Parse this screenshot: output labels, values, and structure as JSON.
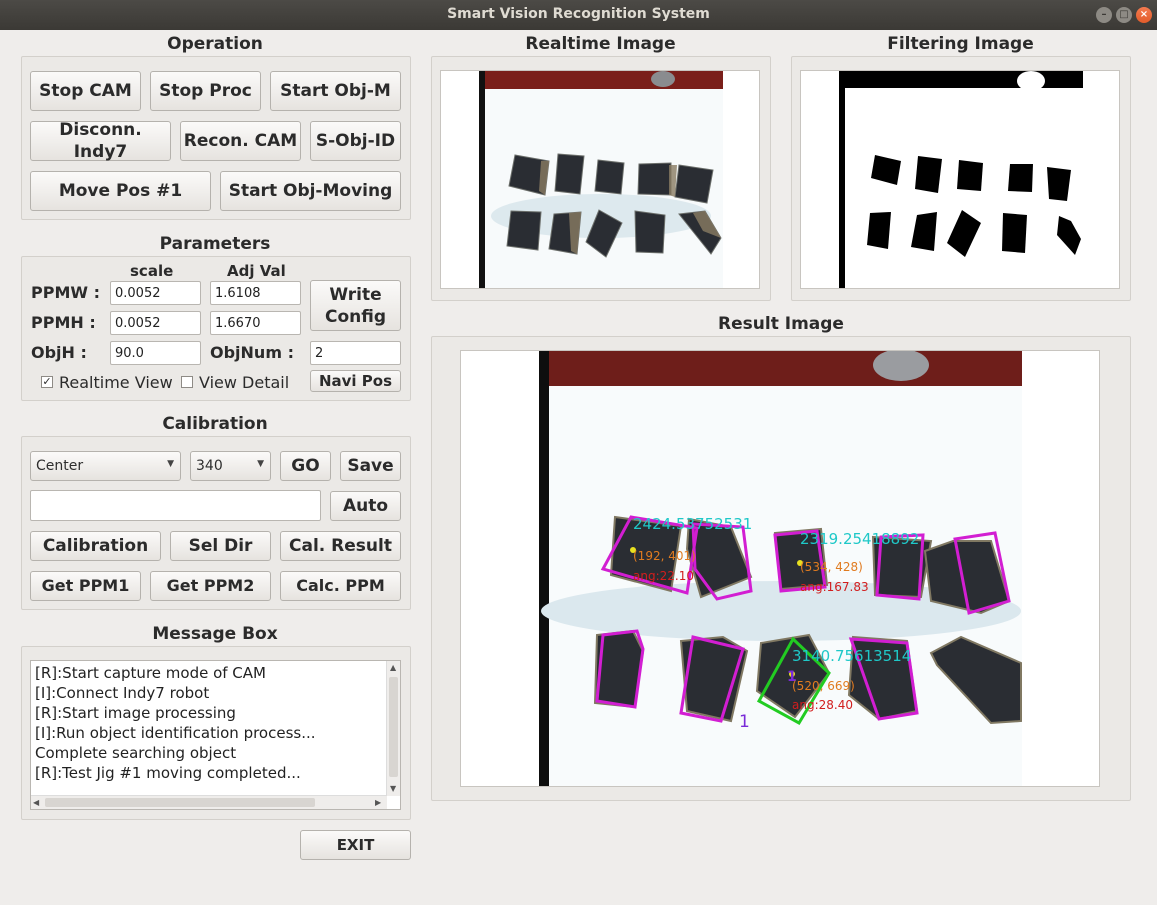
{
  "window": {
    "title": "Smart Vision Recognition System",
    "controls": [
      "minimize-icon",
      "maximize-icon",
      "close-icon"
    ]
  },
  "operation": {
    "title": "Operation",
    "buttons": {
      "stop_cam": "Stop CAM",
      "stop_proc": "Stop Proc",
      "start_obj_m": "Start Obj-M",
      "disconn_indy7": "Disconn. Indy7",
      "recon_cam": "Recon. CAM",
      "s_obj_id": "S-Obj-ID",
      "move_pos_1": "Move Pos #1",
      "start_obj_moving": "Start Obj-Moving"
    }
  },
  "parameters": {
    "title": "Parameters",
    "col_scale": "scale",
    "col_adj": "Adj Val",
    "ppmw_label": "PPMW :",
    "ppmw_scale": "0.0052",
    "ppmw_adj": "1.6108",
    "ppmh_label": "PPMH :",
    "ppmh_scale": "0.0052",
    "ppmh_adj": "1.6670",
    "objh_label": "ObjH :",
    "objh_value": "90.0",
    "objnum_label": "ObjNum :",
    "objnum_value": "2",
    "write_config_line1": "Write",
    "write_config_line2": "Config",
    "navi_pos": "Navi Pos",
    "realtime_view_label": "Realtime View",
    "realtime_view_checked": true,
    "view_detail_label": "View Detail",
    "view_detail_checked": false
  },
  "calibration": {
    "title": "Calibration",
    "position_select": "Center",
    "size_select": "340",
    "go": "GO",
    "save": "Save",
    "path_value": "",
    "auto": "Auto",
    "calibration": "Calibration",
    "sel_dir": "Sel Dir",
    "cal_result": "Cal. Result",
    "get_ppm1": "Get PPM1",
    "get_ppm2": "Get PPM2",
    "calc_ppm": "Calc. PPM"
  },
  "message_box": {
    "title": "Message Box",
    "lines": [
      "[R]:Start capture mode of CAM",
      "[I]:Connect Indy7 robot",
      "[R]:Start image processing",
      "[I]:Run object identification process...",
      "Complete searching object",
      "[R]:Test Jig #1 moving completed..."
    ]
  },
  "exit": "EXIT",
  "images": {
    "realtime_title": "Realtime Image",
    "filtering_title": "Filtering Image",
    "result_title": "Result Image",
    "overlays": {
      "obj1_area": "2424.53752531",
      "obj1_center": "(192, 401)",
      "obj1_angle": "ang:22.10",
      "obj2_area": "2319.25418892",
      "obj2_center": "(534, 428)",
      "obj2_angle": "ang:167.83",
      "obj3_area": "3140.75613514",
      "obj3_center": "(520, 669)",
      "obj3_angle": "ang:28.40",
      "obj3_index": "1",
      "selected_marker": "1"
    }
  },
  "colors": {
    "contour": "#d21ed2",
    "selected_contour": "#22cc22",
    "area_text": "#1fc8c8",
    "center_text": "#e07b20",
    "angle_text": "#d21e1e",
    "index_text": "#7a2bd8"
  }
}
